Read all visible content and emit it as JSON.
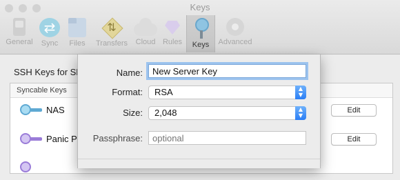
{
  "window": {
    "title": "Keys"
  },
  "toolbar": {
    "items": [
      {
        "label": "General",
        "icon": "general-icon"
      },
      {
        "label": "Sync",
        "icon": "sync-icon"
      },
      {
        "label": "Files",
        "icon": "files-icon"
      },
      {
        "label": "Transfers",
        "icon": "transfers-icon"
      },
      {
        "label": "Cloud",
        "icon": "cloud-icon"
      },
      {
        "label": "Rules",
        "icon": "rules-icon"
      },
      {
        "label": "Keys",
        "icon": "key-icon",
        "active": true
      },
      {
        "label": "Advanced",
        "icon": "gear-icon"
      }
    ]
  },
  "main": {
    "section_title": "SSH Keys for SF",
    "list_header": "Syncable Keys",
    "keys": [
      {
        "name": "NAS",
        "edit_label": "Edit",
        "key_color": "#7fc3e6"
      },
      {
        "name": "Panic Pr",
        "edit_label": "Edit",
        "key_color": "#b69be6"
      }
    ]
  },
  "sheet": {
    "name_label": "Name:",
    "name_value": "New Server Key",
    "format_label": "Format:",
    "format_value": "RSA",
    "size_label": "Size:",
    "size_value": "2,048",
    "passphrase_label": "Passphrase:",
    "passphrase_placeholder": "optional"
  },
  "colors": {
    "focus_ring": "#9cc3ee",
    "stepper_blue": "#2a7ef5"
  }
}
